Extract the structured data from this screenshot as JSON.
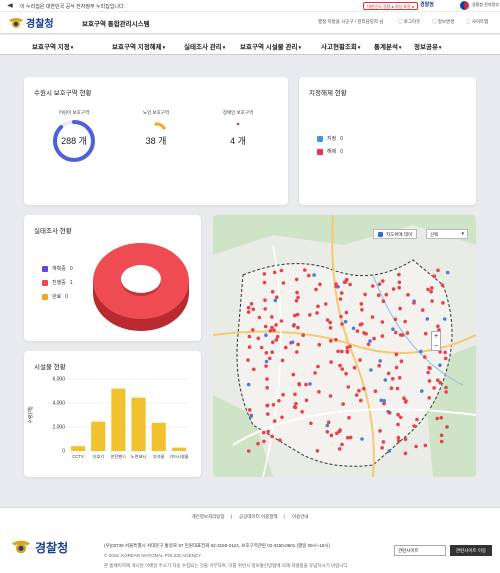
{
  "gov_banner": {
    "text": "이 누리집은 대한민국 공식 전자정부 누리집입니다.",
    "badge": "대한민국 경찰 ● 여성 포함 ●",
    "mini_logo": "경찰청",
    "emblem_label": "경찰청 전자정부"
  },
  "header": {
    "brand": "경찰청",
    "system_title": "보호구역 통합관리시스템",
    "user_info": "행정 지방을 시군구 / 관리담당자 님",
    "links": [
      "로그아웃",
      "정보변경",
      "사이트맵"
    ]
  },
  "nav": [
    "보호구역 지정",
    "보호구역 지정해제",
    "실태조사 관리",
    "보호구역 시설물 관리",
    "사고현황조회",
    "통계분석",
    "정보공유"
  ],
  "zones": {
    "title": "수원시 보호구역 현황",
    "items": [
      {
        "label": "어린이 보호구역",
        "value": "288 개",
        "color": "#4b62d8",
        "fraction": 0.88
      },
      {
        "label": "노인 보호구역",
        "value": "38 개",
        "color": "#f5a524",
        "fraction": 0.12
      },
      {
        "label": "장애인 보호구역",
        "value": "4 개",
        "color": "#e63b4a",
        "fraction": 0.01
      }
    ]
  },
  "designation": {
    "title": "지정해제 현황",
    "legend": [
      {
        "label": "지정",
        "count": "0",
        "color": "#4a90e2"
      },
      {
        "label": "해제",
        "count": "0",
        "color": "#e63b4a"
      }
    ]
  },
  "survey": {
    "title": "실태조사 현황",
    "legend": [
      {
        "label": "계획중",
        "count": "0",
        "color": "#5b4be0"
      },
      {
        "label": "진행중",
        "count": "1",
        "color": "#e84a4f"
      },
      {
        "label": "완료",
        "count": "0",
        "color": "#f5a524"
      }
    ]
  },
  "facilities": {
    "title": "시설물 현황",
    "ylabel": "수량(개)"
  },
  "chart_data": {
    "type": "bar",
    "categories": [
      "CCTV",
      "신호기",
      "안전펜스",
      "노면표시",
      "부속물",
      "기타시설물"
    ],
    "values": [
      400,
      2450,
      5200,
      4450,
      2350,
      280
    ],
    "ylabel": "수량(개)",
    "ylim": [
      0,
      6000
    ],
    "yticks": [
      "0",
      "2,000",
      "4,000",
      "6,000"
    ],
    "color": "#f2c12e",
    "grid": true
  },
  "map": {
    "layer_label": "지도위에 데이",
    "select_value": "선택",
    "zoom_in": "+",
    "zoom_out": "−"
  },
  "footer": {
    "links": [
      "개인정보처리방침",
      "공공데이터 이용정책",
      "이용안내"
    ],
    "brand": "경찰청",
    "address": "(우)03739 서울특별시 서대문구 통일로 97     민원대표전화 02-3150-2124, 보호구역관련 02-3150-0601 (평일 09시~18시)",
    "copyright": "© 2018. KOREAN NATIONAL POLICE AGENCY",
    "notice": "본 홈페이지에 게시된 이메일 주소가 자동 수집되는 것을 거부하며, 이를 위반시 정보통신망법에 의해 처벌됨을 유념하시기 바랍니다.",
    "family_select": "관련사이트",
    "family_button": "관련사이트 이동"
  }
}
